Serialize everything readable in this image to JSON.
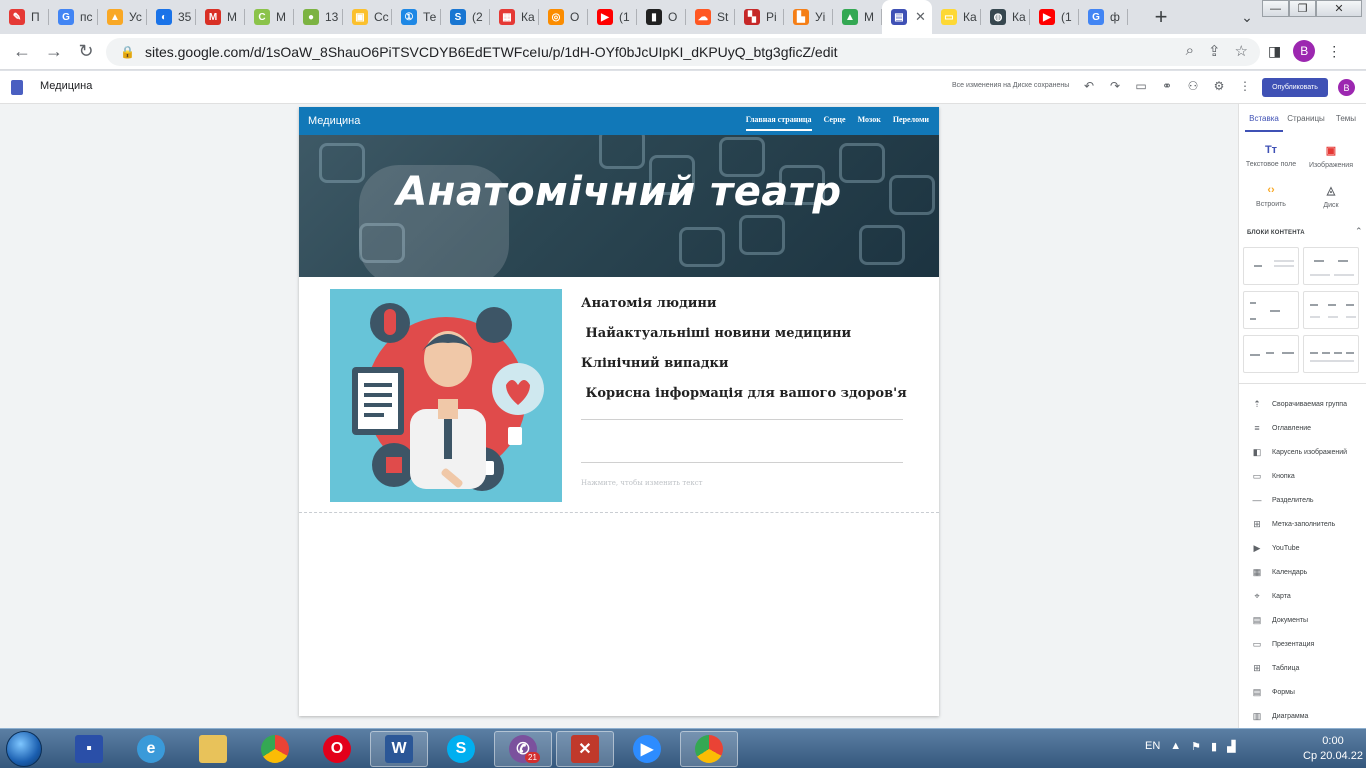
{
  "browser": {
    "tabs": [
      {
        "label": "П",
        "color": "#e53935",
        "glyph": "✎"
      },
      {
        "label": "пс",
        "color": "#4285f4",
        "glyph": "G"
      },
      {
        "label": "Ус",
        "color": "#f9a825",
        "glyph": "▲"
      },
      {
        "label": "35",
        "color": "#1a73e8",
        "glyph": "◐"
      },
      {
        "label": "M",
        "color": "#d93025",
        "glyph": "M"
      },
      {
        "label": "М",
        "color": "#8bc34a",
        "glyph": "C"
      },
      {
        "label": "13",
        "color": "#7cb342",
        "glyph": "●"
      },
      {
        "label": "Сс",
        "color": "#fbc02d",
        "glyph": "▣"
      },
      {
        "label": "Те",
        "color": "#1e88e5",
        "glyph": "①"
      },
      {
        "label": "(2",
        "color": "#1976d2",
        "glyph": "S"
      },
      {
        "label": "Ка",
        "color": "#e53935",
        "glyph": "▦"
      },
      {
        "label": "О",
        "color": "#fb8c00",
        "glyph": "◎"
      },
      {
        "label": "(1",
        "color": "#ff0000",
        "glyph": "▶"
      },
      {
        "label": "О",
        "color": "#212121",
        "glyph": "▮"
      },
      {
        "label": "St",
        "color": "#ff5722",
        "glyph": "☁"
      },
      {
        "label": "Рі",
        "color": "#c62828",
        "glyph": "▚"
      },
      {
        "label": "Уі",
        "color": "#f57f17",
        "glyph": "▙"
      },
      {
        "label": "М",
        "color": "#34a853",
        "glyph": "▲"
      },
      {
        "label": "",
        "color": "#3f51b5",
        "glyph": "▤",
        "active": true
      },
      {
        "label": "Ка",
        "color": "#fdd835",
        "glyph": "▭"
      },
      {
        "label": "Ка",
        "color": "#37474f",
        "glyph": "◍"
      },
      {
        "label": "(1",
        "color": "#ff0000",
        "glyph": "▶"
      },
      {
        "label": "ф",
        "color": "#4285f4",
        "glyph": "G"
      }
    ],
    "tab_close": "✕",
    "new_tab": "+",
    "url": "sites.google.com/d/1sOaW_8ShauO6PiTSVCDYB6EdETWFceIu/p/1dH-OYf0bJcUIpKI_dKPUyQ_btg3gficZ/edit",
    "profile_initial": "B"
  },
  "sites": {
    "doc_title": "Медицина",
    "saved_status": "Все изменения на Диске сохранены",
    "publish_label": "Опубликовать",
    "avatar_initial": "B"
  },
  "site": {
    "name": "Медицина",
    "nav": [
      {
        "label": "Главная страница",
        "current": true
      },
      {
        "label": "Серце"
      },
      {
        "label": "Мозок"
      },
      {
        "label": "Переломи"
      }
    ],
    "banner_title": "Анатомічний театр",
    "links": [
      "Анатомія людини",
      " Найактуальніші новини медицини",
      "Клінічний випадки",
      " Корисна інформація для вашого здоров'я"
    ],
    "placeholder_hint": "Нажмите, чтобы изменить текст"
  },
  "panel": {
    "tabs": [
      "Вставка",
      "Страницы",
      "Темы"
    ],
    "insert": [
      {
        "label": "Текстовое поле",
        "icon": "Tт"
      },
      {
        "label": "Изображения",
        "icon": "▣"
      },
      {
        "label": "Встроить",
        "icon": "‹›"
      },
      {
        "label": "Диск",
        "icon": "◬"
      }
    ],
    "blocks_title": "БЛОКИ КОНТЕНТА",
    "components": [
      {
        "label": "Сворачиваемая группа",
        "icon": "⇡"
      },
      {
        "label": "Оглавление",
        "icon": "≡"
      },
      {
        "label": "Карусель изображений",
        "icon": "◧"
      },
      {
        "label": "Кнопка",
        "icon": "▭"
      },
      {
        "label": "Разделитель",
        "icon": "—"
      },
      {
        "label": "Метка-заполнитель",
        "icon": "⊞"
      },
      {
        "label": "YouTube",
        "icon": "▶"
      },
      {
        "label": "Календарь",
        "icon": "▦"
      },
      {
        "label": "Карта",
        "icon": "⌖"
      },
      {
        "label": "Документы",
        "icon": "▤"
      },
      {
        "label": "Презентация",
        "icon": "▭"
      },
      {
        "label": "Таблица",
        "icon": "⊞"
      },
      {
        "label": "Формы",
        "icon": "▤"
      },
      {
        "label": "Диаграмма",
        "icon": "▥"
      }
    ]
  },
  "taskbar": {
    "lang": "EN",
    "time": "0:00",
    "date": "Ср 20.04.22",
    "viber_badge": "21"
  }
}
